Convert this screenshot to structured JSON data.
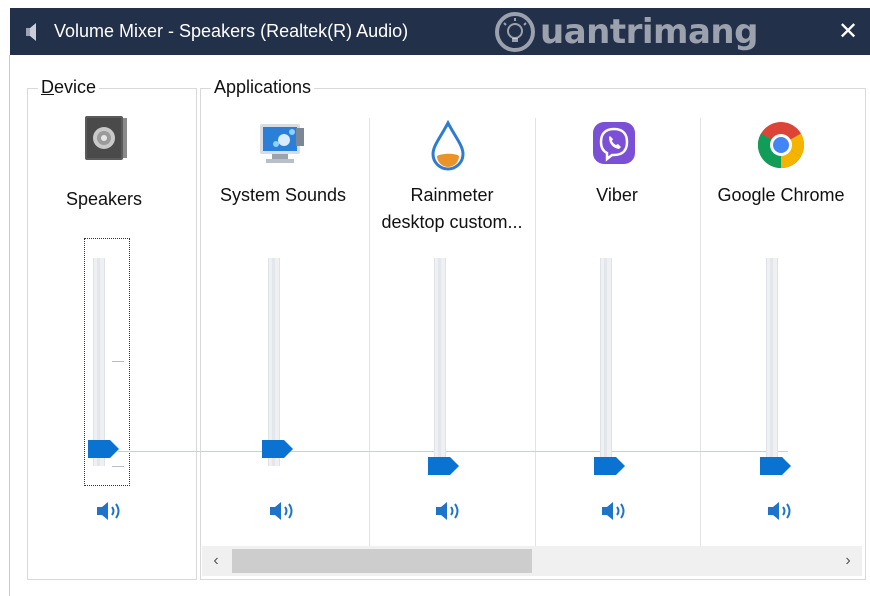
{
  "window": {
    "title": "Volume Mixer - Speakers (Realtek(R) Audio)",
    "watermark_text": "uantrimang",
    "close_symbol": "✕"
  },
  "device": {
    "group_label_key": "D",
    "group_label_rest": "evice",
    "name": "Speakers",
    "icon": "speaker-device-icon",
    "volume_percent": 8
  },
  "applications": {
    "group_label": "Applications",
    "items": [
      {
        "name": "System Sounds",
        "icon": "system-sounds-icon",
        "volume_percent": 8
      },
      {
        "name_line1": "Rainmeter",
        "name_line2": "desktop custom...",
        "icon": "rainmeter-icon",
        "volume_percent": 0
      },
      {
        "name": "Viber",
        "icon": "viber-icon",
        "volume_percent": 0
      },
      {
        "name": "Google Chrome",
        "icon": "chrome-icon",
        "volume_percent": 0
      }
    ]
  },
  "scrollbar": {
    "left_arrow": "‹",
    "right_arrow": "›"
  },
  "colors": {
    "titlebar": "#22304a",
    "accent": "#0a72d1"
  }
}
